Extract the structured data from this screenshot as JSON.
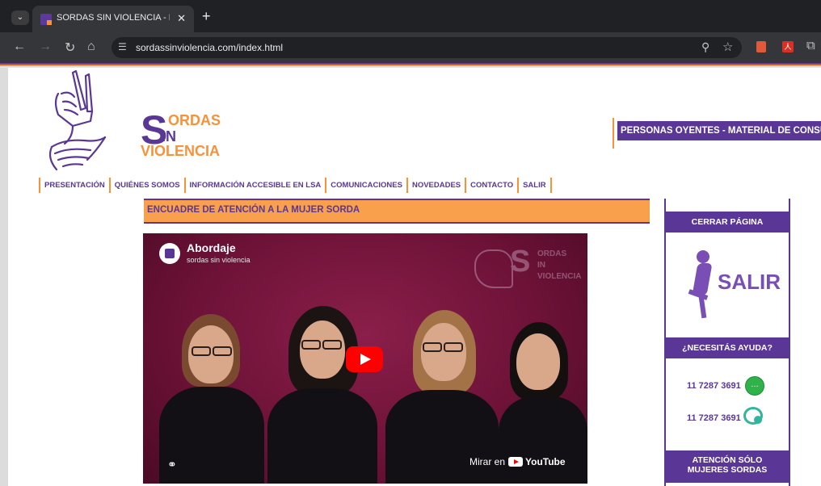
{
  "browser": {
    "tab_title": "SORDAS SIN VIOLENCIA - Proto",
    "url": "sordassinviolencia.com/index.html",
    "tab_menu_icon": "chevron-down-icon",
    "close_icon": "close-icon",
    "new_tab_icon": "plus-icon",
    "ext_pdf_label": "人"
  },
  "logo": {
    "big_s": "S",
    "line1": "ORDAS",
    "line2": "IN",
    "line3": "VIOLENCIA"
  },
  "header": {
    "consult_button": "PERSONAS OYENTES - MATERIAL DE CONSULTA"
  },
  "nav": {
    "items": [
      "PRESENTACIÓN",
      "QUIÉNES SOMOS",
      "INFORMACIÓN ACCESIBLE EN LSA",
      "COMUNICACIONES",
      "NOVEDADES",
      "CONTACTO",
      "SALIR"
    ]
  },
  "main": {
    "section_title": "ENCUADRE DE ATENCIÓN A LA MUJER SORDA",
    "video": {
      "title": "Abordaje",
      "channel": "sordas sin violencia",
      "watch_on": "Mirar en",
      "youtube": "YouTube",
      "watermark_s": "S",
      "watermark_1": "ORDAS",
      "watermark_2": "IN",
      "watermark_3": "VIOLENCIA"
    }
  },
  "sidebar": {
    "close_page": "CERRAR PÁGINA",
    "salir": "SALIR",
    "help": "¿NECESITÁS AYUDA?",
    "phone1": "11 7287 3691",
    "phone2": "11 7287 3691",
    "deaf_only_line1": "ATENCIÓN SÓLO",
    "deaf_only_line2": "MUJERES SORDAS"
  },
  "colors": {
    "purple": "#5a3796",
    "orange": "#f7923a",
    "section_bg": "#f9a04c"
  }
}
